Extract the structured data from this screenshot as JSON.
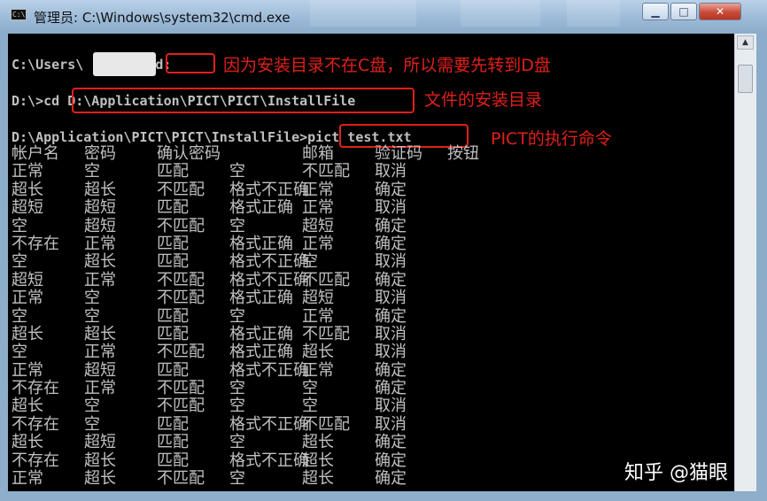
{
  "window": {
    "title": "管理员: C:\\Windows\\system32\\cmd.exe",
    "icon_label": "C:\\",
    "controls": {
      "minimize": "▁",
      "maximize": "□",
      "close": "✕"
    }
  },
  "console": {
    "line1": {
      "prefix": "C:\\Users\\",
      "suffix": ">",
      "cmd": "d:"
    },
    "line2": {
      "prompt": "D:\\>cd ",
      "path": "D:\\Application\\PICT\\PICT\\InstallFile"
    },
    "line3": {
      "prompt": "D:\\Application\\PICT\\PICT\\InstallFile>",
      "cmd": "pict test.txt"
    },
    "headers": [
      "帐户名",
      "密码",
      "确认密码",
      "邮箱",
      "验证码",
      "按钮"
    ],
    "rows": [
      [
        "正常",
        "空",
        "匹配",
        "空",
        "不匹配",
        "取消"
      ],
      [
        "超长",
        "超长",
        "不匹配",
        "格式不正确",
        "正常",
        "确定"
      ],
      [
        "超短",
        "超短",
        "匹配",
        "格式正确",
        "正常",
        "取消"
      ],
      [
        "空",
        "超短",
        "不匹配",
        "空",
        "超短",
        "确定"
      ],
      [
        "不存在",
        "正常",
        "匹配",
        "格式正确",
        "正常",
        "确定"
      ],
      [
        "空",
        "超长",
        "匹配",
        "格式不正确",
        "空",
        "取消"
      ],
      [
        "超短",
        "正常",
        "不匹配",
        "格式不正确",
        "不匹配",
        "确定"
      ],
      [
        "正常",
        "空",
        "不匹配",
        "格式正确",
        "超短",
        "取消"
      ],
      [
        "空",
        "空",
        "匹配",
        "空",
        "正常",
        "确定"
      ],
      [
        "超长",
        "超长",
        "匹配",
        "格式正确",
        "不匹配",
        "取消"
      ],
      [
        "空",
        "正常",
        "不匹配",
        "格式正确",
        "超长",
        "取消"
      ],
      [
        "正常",
        "超短",
        "匹配",
        "格式不正确",
        "正常",
        "确定"
      ],
      [
        "不存在",
        "正常",
        "不匹配",
        "空",
        "空",
        "确定"
      ],
      [
        "超长",
        "空",
        "不匹配",
        "空",
        "空",
        "取消"
      ],
      [
        "不存在",
        "空",
        "匹配",
        "格式不正确",
        "不匹配",
        "取消"
      ],
      [
        "超长",
        "超短",
        "匹配",
        "空",
        "超长",
        "确定"
      ],
      [
        "不存在",
        "超长",
        "匹配",
        "格式不正确",
        "超长",
        "确定"
      ],
      [
        "正常",
        "超长",
        "不匹配",
        "空",
        "超长",
        "确定"
      ]
    ]
  },
  "annotations": {
    "a1": "因为安装目录不在C盘，所以需要先转到D盘",
    "a2": "文件的安装目录",
    "a3": "PICT的执行命令"
  },
  "watermark": "知乎 @猫眼",
  "colors": {
    "annotation": "#e0201b",
    "console_bg": "#000000",
    "console_text": "#c0c0c0"
  }
}
